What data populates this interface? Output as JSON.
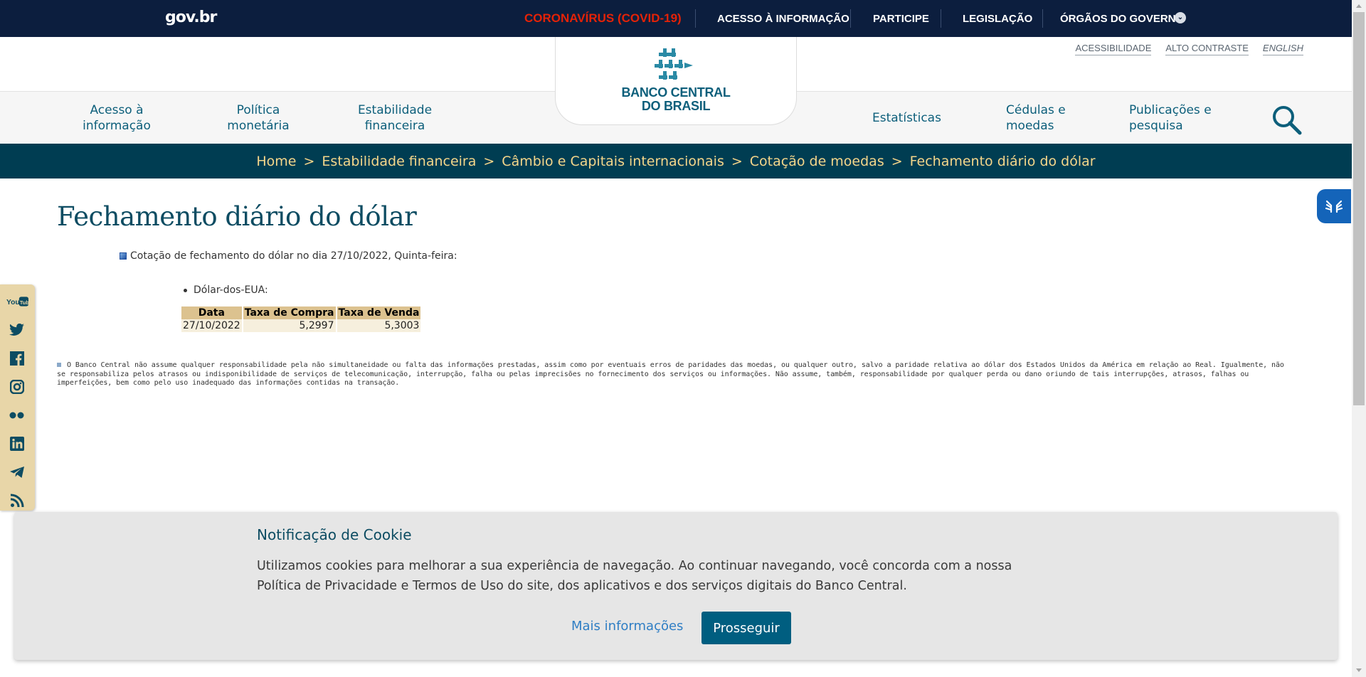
{
  "gov_bar": {
    "logo": "gov.br",
    "covid": "CORONAVÍRUS (COVID-19)",
    "links": [
      "ACESSO À INFORMAÇÃO",
      "PARTICIPE",
      "LEGISLAÇÃO",
      "ÓRGÃOS DO GOVERNO"
    ]
  },
  "accessibility": {
    "acessibilidade": "ACESSIBILIDADE",
    "alto_contraste": "ALTO CONTRASTE",
    "english": "ENGLISH"
  },
  "logo": {
    "line1": "BANCO CENTRAL",
    "line2": "DO BRASIL"
  },
  "main_nav": {
    "acesso": [
      "Acesso à",
      "informação"
    ],
    "politica": [
      "Política",
      "monetária"
    ],
    "estabilidade": [
      "Estabilidade",
      "financeira"
    ],
    "estatisticas": "Estatísticas",
    "cedulas": [
      "Cédulas e",
      "moedas"
    ],
    "publicacoes": [
      "Publicações e",
      "pesquisa"
    ]
  },
  "breadcrumb": [
    "Home",
    "Estabilidade financeira",
    "Câmbio e Capitais internacionais",
    "Cotação de moedas",
    "Fechamento diário do dólar"
  ],
  "breadcrumb_sep": ">",
  "page": {
    "title": "Fechamento diário do dólar",
    "intro": "Cotação de fechamento do dólar no dia 27/10/2022, Quinta-feira:",
    "currency": "Dólar-dos-EUA:",
    "table": {
      "headers": [
        "Data",
        "Taxa de Compra",
        "Taxa de Venda"
      ],
      "rows": [
        [
          "27/10/2022",
          "5,2997",
          "5,3003"
        ]
      ]
    },
    "disclaimer": "O Banco Central não assume qualquer responsabilidade pela não simultaneidade ou falta das informações prestadas, assim como por eventuais erros de paridades das moedas, ou qualquer outro, salvo a paridade relativa ao dólar dos Estados Unidos da América em relação ao Real. Igualmente, não se responsabiliza pelos atrasos ou indisponibilidade de serviços de telecomunicação, interrupção, falha ou pelas imprecisões no fornecimento dos serviços ou informações. Não assume, também, responsabilidade por qualquer perda ou dano oriundo de tais interrupções, atrasos, falhas ou imperfeições, bem como pelo uso inadequado das informações contidas na transação."
  },
  "social": [
    "youtube-icon",
    "twitter-icon",
    "facebook-icon",
    "instagram-icon",
    "flickr-icon",
    "linkedin-icon",
    "telegram-icon",
    "rss-icon"
  ],
  "cookie": {
    "title": "Notificação de Cookie",
    "text": "Utilizamos cookies para melhorar a sua experiência de navegação. Ao continuar navegando, você concorda com a nossa Política de Privacidade e Termos de Uso do site, dos aplicativos e dos serviços digitais do Banco Central.",
    "more": "Mais informações",
    "button": "Prosseguir"
  },
  "colors": {
    "gov_bar": "#0c1e3e",
    "covid": "#e52207",
    "brand": "#0d5f7b",
    "breadcrumb_bg": "#003d52",
    "breadcrumb_text": "#f5d68a",
    "table_header": "#dcc28f",
    "cookie_button": "#005e80"
  }
}
